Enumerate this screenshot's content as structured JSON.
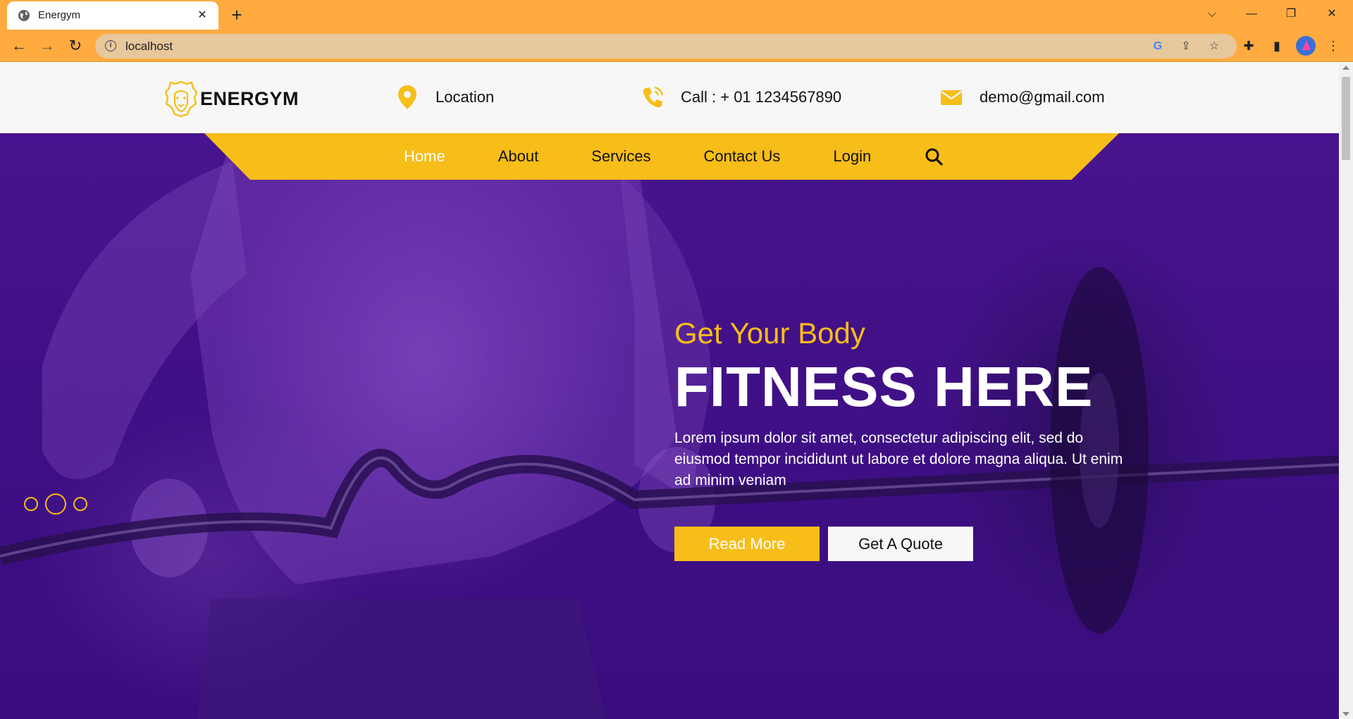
{
  "browser": {
    "tab_title": "Energym",
    "url": "localhost",
    "tab_close": "✕",
    "new_tab": "+",
    "back": "←",
    "forward": "→",
    "reload": "↻"
  },
  "site": {
    "logo_text": "ENERGYM",
    "contacts": [
      {
        "icon": "location-pin-icon",
        "text": "Location"
      },
      {
        "icon": "phone-icon",
        "text": "Call : + 01 1234567890"
      },
      {
        "icon": "mail-icon",
        "text": "demo@gmail.com"
      }
    ],
    "nav": [
      {
        "label": "Home",
        "active": true
      },
      {
        "label": "About"
      },
      {
        "label": "Services"
      },
      {
        "label": "Contact Us"
      },
      {
        "label": "Login"
      }
    ],
    "accent": "#f7bd19",
    "hero_bg": "#3e0f84"
  },
  "hero": {
    "subtitle": "Get Your Body",
    "title": "FITNESS HERE",
    "description": "Lorem ipsum dolor sit amet, consectetur adipiscing elit, sed do eiusmod tempor incididunt ut labore et dolore magna aliqua. Ut enim ad minim veniam",
    "primary_button": "Read More",
    "secondary_button": "Get A Quote",
    "slides": 3,
    "active_slide": 2
  }
}
